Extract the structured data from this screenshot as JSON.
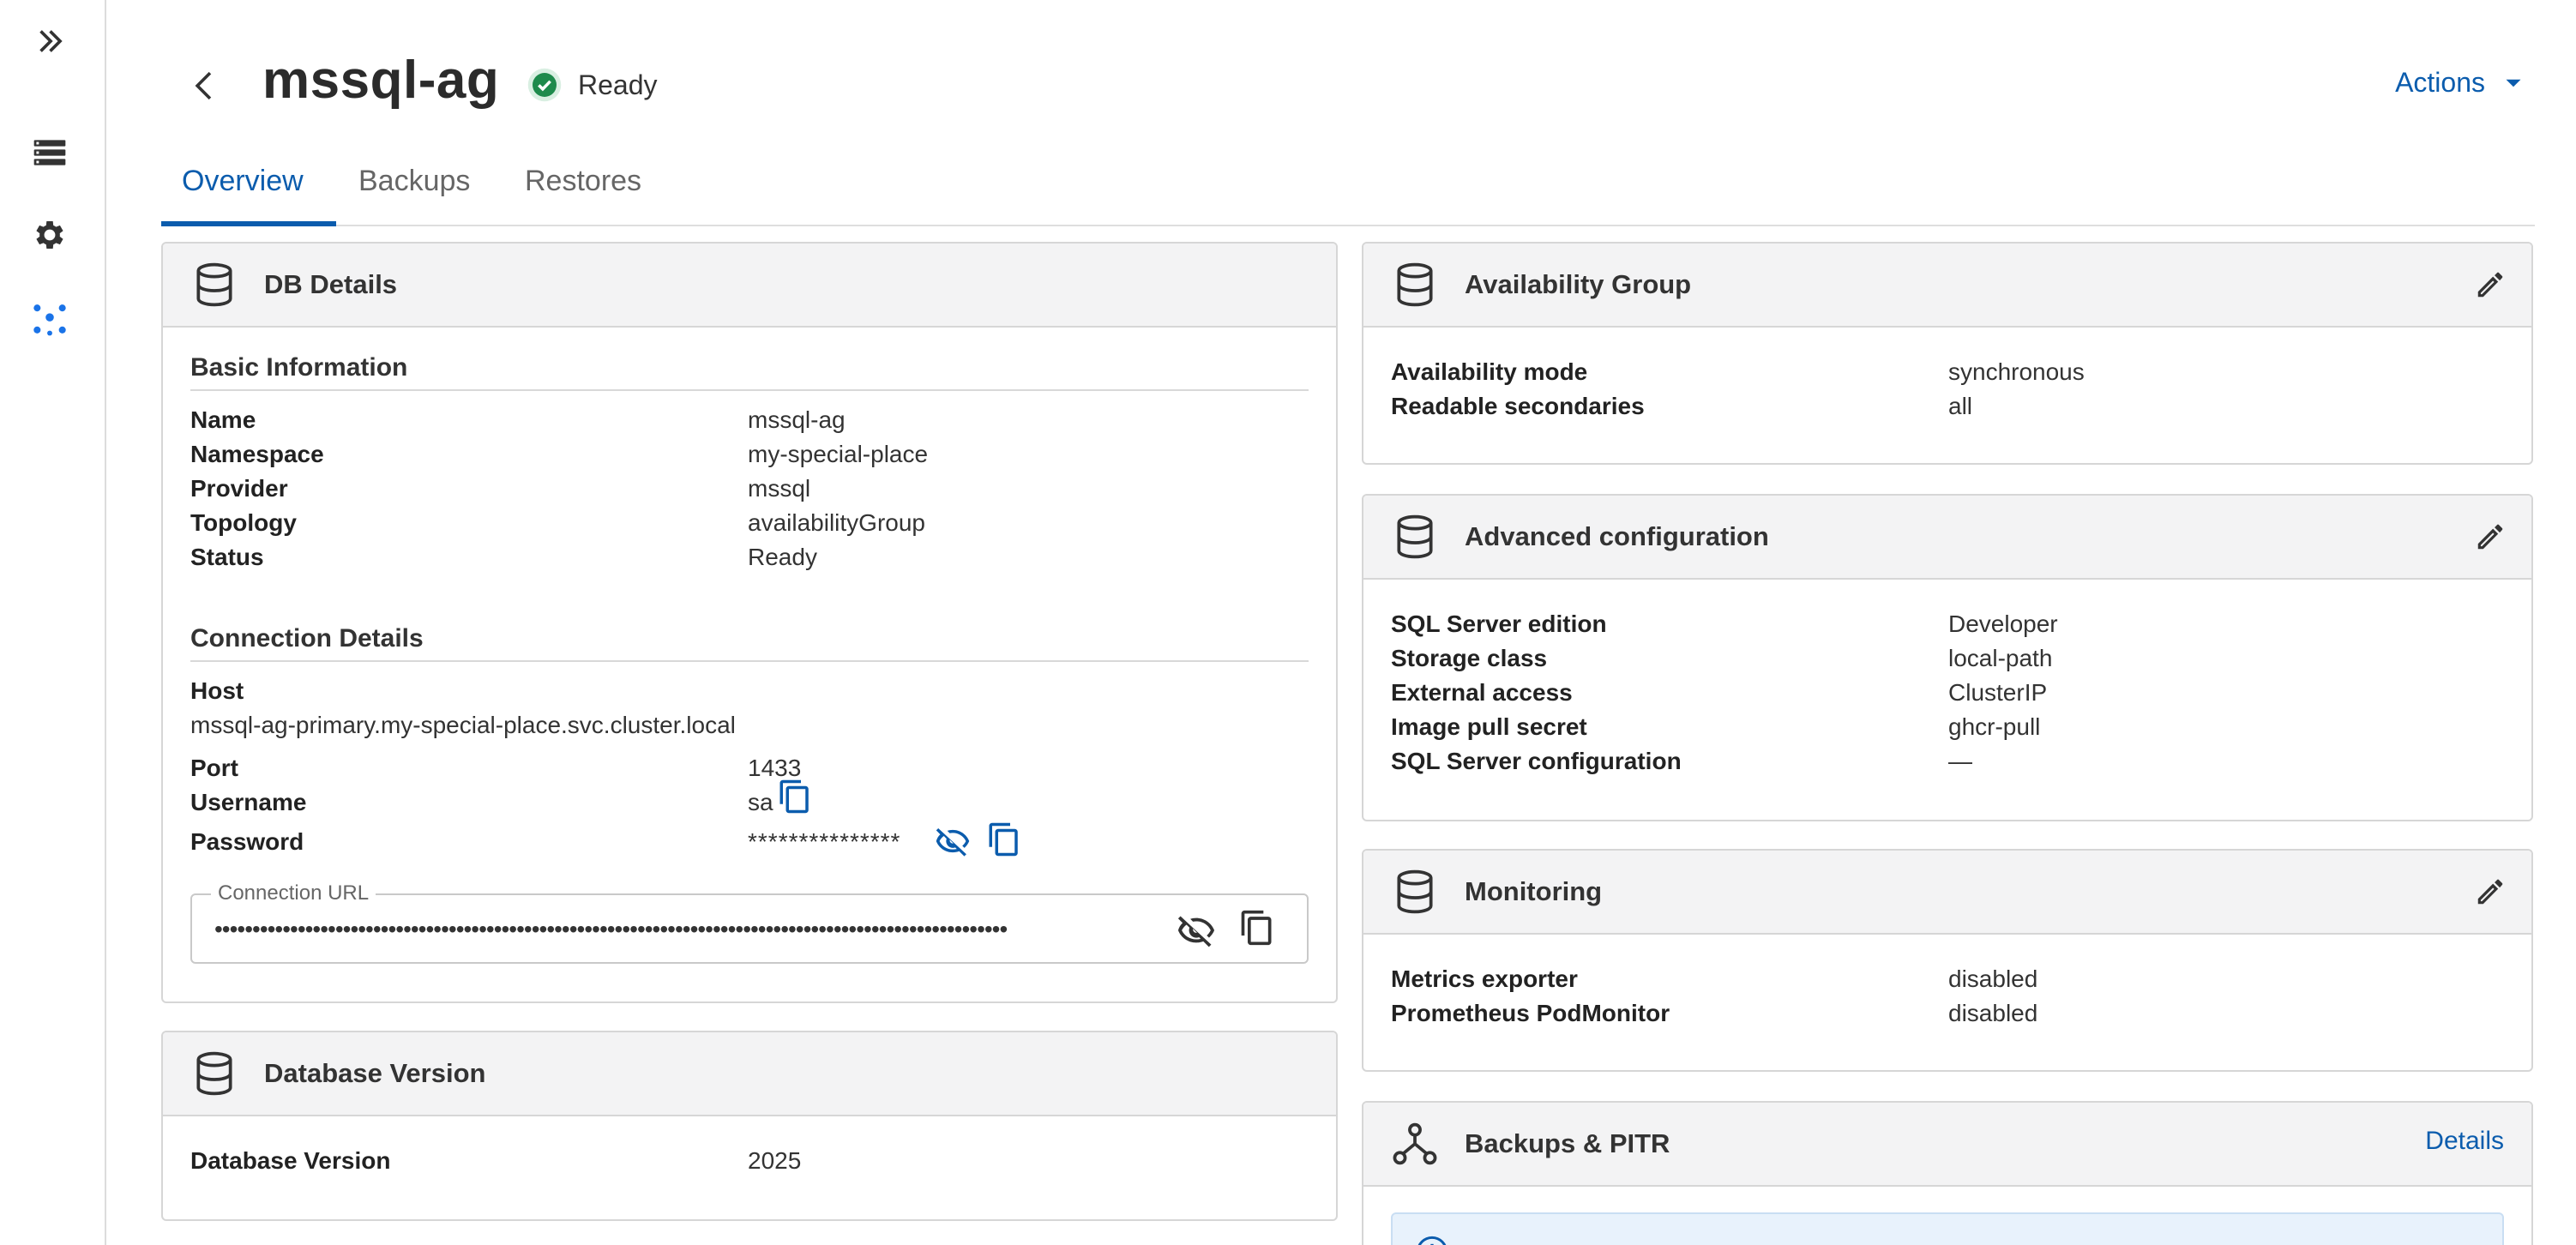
{
  "header": {
    "title": "mssql-ag",
    "status": "Ready",
    "actions_label": "Actions"
  },
  "tabs": [
    {
      "label": "Overview",
      "active": true
    },
    {
      "label": "Backups",
      "active": false
    },
    {
      "label": "Restores",
      "active": false
    }
  ],
  "db_details": {
    "title": "DB Details",
    "basic_title": "Basic Information",
    "basic": [
      {
        "key": "Name",
        "value": "mssql-ag"
      },
      {
        "key": "Namespace",
        "value": "my-special-place"
      },
      {
        "key": "Provider",
        "value": "mssql"
      },
      {
        "key": "Topology",
        "value": "availabilityGroup"
      },
      {
        "key": "Status",
        "value": "Ready"
      }
    ],
    "connection_title": "Connection Details",
    "host_label": "Host",
    "host_value": "mssql-ag-primary.my-special-place.svc.cluster.local",
    "port_label": "Port",
    "port_value": "1433",
    "username_label": "Username",
    "username_value": "sa",
    "password_label": "Password",
    "password_value": "***************",
    "connection_url_label": "Connection URL",
    "connection_url_value": "•••••••••••••••••••••••••••••••••••••••••••••••••••••••••••••••••••••••••••••••••••••••••••••••••••••••••"
  },
  "database_version": {
    "title": "Database Version",
    "key": "Database Version",
    "value": "2025"
  },
  "availability_group": {
    "title": "Availability Group",
    "rows": [
      {
        "key": "Availability mode",
        "value": "synchronous"
      },
      {
        "key": "Readable secondaries",
        "value": "all"
      }
    ]
  },
  "advanced_configuration": {
    "title": "Advanced configuration",
    "rows": [
      {
        "key": "SQL Server edition",
        "value": "Developer"
      },
      {
        "key": "Storage class",
        "value": "local-path"
      },
      {
        "key": "External access",
        "value": "ClusterIP"
      },
      {
        "key": "Image pull secret",
        "value": "ghcr-pull"
      },
      {
        "key": "SQL Server configuration",
        "value": "—"
      }
    ]
  },
  "monitoring": {
    "title": "Monitoring",
    "rows": [
      {
        "key": "Metrics exporter",
        "value": "disabled"
      },
      {
        "key": "Prometheus PodMonitor",
        "value": "disabled"
      }
    ]
  },
  "backups_pitr": {
    "title": "Backups & PITR",
    "details_label": "Details"
  },
  "colors": {
    "accent": "#0b5cad",
    "status_ready": "#1e8a4c",
    "card_header_bg": "#f3f3f4",
    "info_bg": "#e8f2fc"
  },
  "icons": {
    "sidebar": [
      "expand-icon",
      "database-list-icon",
      "gear-icon",
      "cluster-icon"
    ]
  }
}
